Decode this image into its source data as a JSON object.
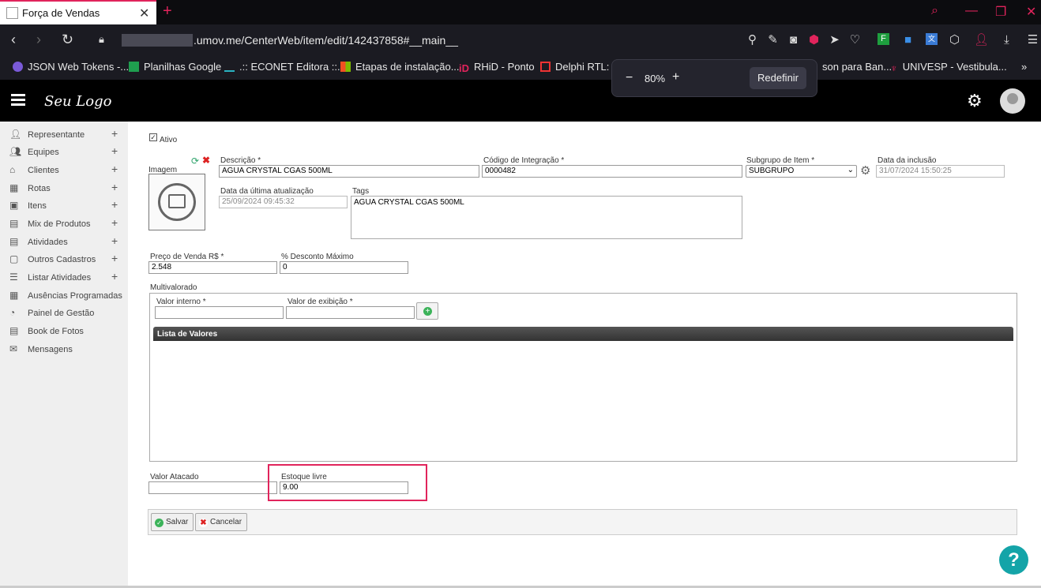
{
  "browser": {
    "tab_title": "Força de Vendas",
    "url_visible": ".umov.me/CenterWeb/item/edit/142437858#__main__",
    "bookmarks": [
      "JSON Web Tokens -...",
      "Planilhas Google",
      ".:: ECONET Editora ::...",
      "Etapas de instalação...",
      "RHiD - Ponto",
      "Delphi RTL: C",
      "son para Ban...",
      "UNIVESP - Vestibula..."
    ],
    "zoom": {
      "level": "80%",
      "reset_label": "Redefinir"
    }
  },
  "app": {
    "logo": "Seu Logo"
  },
  "sidebar": {
    "items": [
      {
        "label": "Representante"
      },
      {
        "label": "Equipes"
      },
      {
        "label": "Clientes"
      },
      {
        "label": "Rotas"
      },
      {
        "label": "Itens"
      },
      {
        "label": "Mix de Produtos"
      },
      {
        "label": "Atividades"
      },
      {
        "label": "Outros Cadastros"
      },
      {
        "label": "Listar Atividades"
      },
      {
        "label": "Ausências Programadas"
      },
      {
        "label": "Painel de Gestão"
      },
      {
        "label": "Book de Fotos"
      },
      {
        "label": "Mensagens"
      }
    ]
  },
  "form": {
    "ativo_label": "Ativo",
    "imagem_label": "Imagem",
    "descricao": {
      "label": "Descrição *",
      "value": "AGUA CRYSTAL CGAS 500ML"
    },
    "codigo": {
      "label": "Código de Integração *",
      "value": "0000482"
    },
    "subgrupo": {
      "label": "Subgrupo de Item *",
      "value": "SUBGRUPO"
    },
    "data_inclusao": {
      "label": "Data da inclusão",
      "value": "31/07/2024 15:50:25"
    },
    "data_atualizacao": {
      "label": "Data da última atualização",
      "value": "25/09/2024 09:45:32"
    },
    "tags": {
      "label": "Tags",
      "value": "AGUA CRYSTAL CGAS 500ML"
    },
    "preco": {
      "label": "Preço de Venda R$ *",
      "value": "2.548"
    },
    "desconto": {
      "label": "% Desconto Máximo",
      "value": "0"
    },
    "multivalorado": {
      "label": "Multivalorado",
      "valor_interno_label": "Valor interno *",
      "valor_exibicao_label": "Valor de exibição *",
      "lista_label": "Lista de Valores"
    },
    "valor_atacado": {
      "label": "Valor Atacado",
      "value": ""
    },
    "estoque_livre": {
      "label": "Estoque livre",
      "value": "9.00"
    },
    "salvar_label": "Salvar",
    "cancelar_label": "Cancelar"
  }
}
